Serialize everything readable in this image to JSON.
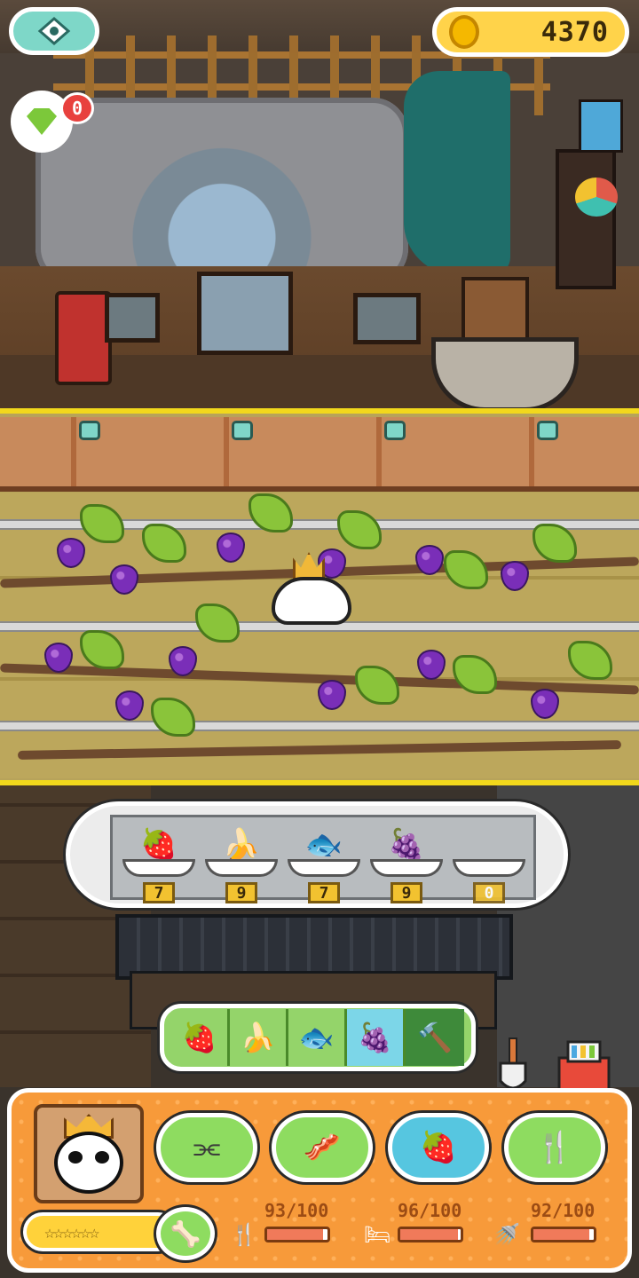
{
  "hud": {
    "menu_icon": "menu-icon",
    "coins": "4370",
    "gem_badge": "0"
  },
  "inventory": [
    {
      "icon": "strawberry-icon",
      "glyph": "🍓",
      "count": "7"
    },
    {
      "icon": "banana-icon",
      "glyph": "🍌",
      "count": "9"
    },
    {
      "icon": "fish-icon",
      "glyph": "🐟",
      "count": "7"
    },
    {
      "icon": "grapes-icon",
      "glyph": "🍇",
      "count": "9"
    },
    {
      "icon": "empty-slot",
      "glyph": "",
      "count": "0"
    }
  ],
  "food_selector": [
    {
      "icon": "strawberry-icon",
      "glyph": "🍓"
    },
    {
      "icon": "banana-icon",
      "glyph": "🍌"
    },
    {
      "icon": "fish-icon",
      "glyph": "🐟"
    },
    {
      "icon": "grapes-icon",
      "glyph": "🍇",
      "active": true
    },
    {
      "icon": "hammer-icon",
      "glyph": "🔨"
    }
  ],
  "actions": [
    {
      "icon": "comb-icon",
      "glyph": "⫘"
    },
    {
      "icon": "bacon-icon",
      "glyph": "🥓"
    },
    {
      "icon": "fruit-icon",
      "glyph": "🍓",
      "selected": true
    },
    {
      "icon": "cutlery-icon",
      "glyph": "🍴"
    }
  ],
  "pet_name": "☆☆☆☆☆☆",
  "stats": [
    {
      "icon": "food-stat-icon",
      "glyph": "🍴",
      "text": "93/100",
      "value": 0.93
    },
    {
      "icon": "sleep-stat-icon",
      "glyph": "🛏",
      "text": "96/100",
      "value": 0.96
    },
    {
      "icon": "clean-stat-icon",
      "glyph": "🚿",
      "text": "92/100",
      "value": 0.92
    }
  ]
}
